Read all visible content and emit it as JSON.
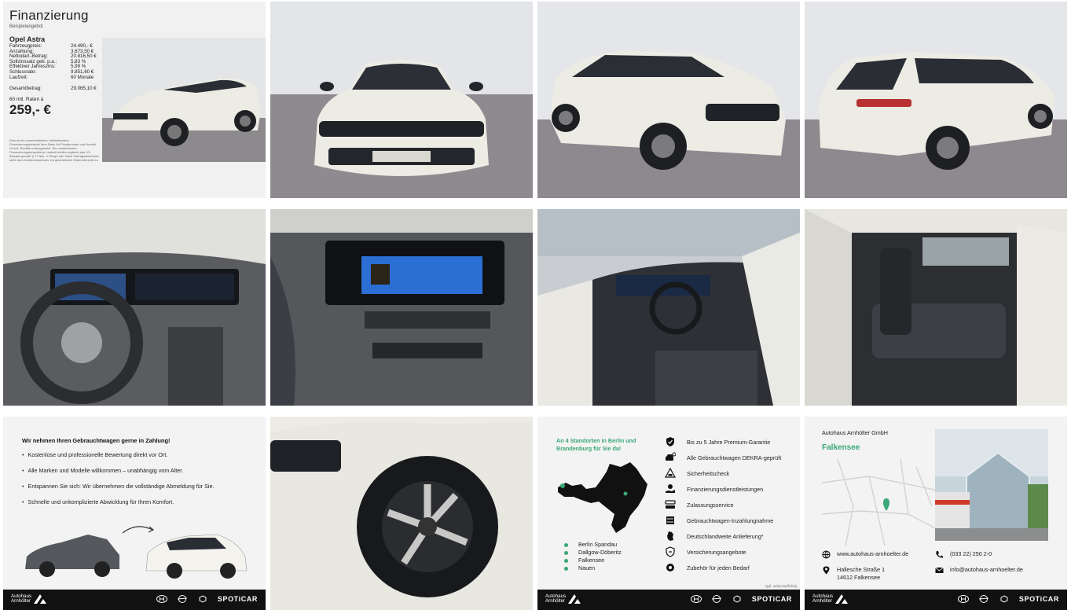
{
  "financing": {
    "title": "Finanzierung",
    "subtitle": "Beispielangebot",
    "model": "Opel Astra",
    "rows": [
      {
        "label": "Fahrzeugpreis:",
        "value": "24.490,- €"
      },
      {
        "label": "Anzahlung:",
        "value": "3.673,50 €"
      },
      {
        "label": "Nettodarl.-Betrag:",
        "value": "20.816,50 €"
      },
      {
        "label": "Sollzinssatz geb. p.a.:",
        "value": "5,83 %"
      },
      {
        "label": "Effektiver Jahreszins:",
        "value": "5,99 %"
      },
      {
        "label": "Schlussrate:",
        "value": "9.851,60 €"
      },
      {
        "label": "Laufzeit:",
        "value": "60 Monate"
      }
    ],
    "total_label": "Gesamtbetrag:",
    "total_value": "29.065,10 €",
    "rates_label": "60 mtl. Raten à",
    "rate_value": "259,- €",
    "disclaimer": "Dies ist ein unverbindliches, freibleibendes Finanzierungsbeispiel Ihrer Bank für Privatkunden und Handel GmbH. Bonität vorausgesetzt. Die vorstehenden Finanzierungsbeispiele je Laufzeit stellen zugleich das 2/3 Beispiel gemäß § 17 Abs. 4 PAngV dar. Nach Vertragsabschluss steht dem Darlehensnehmer ein gesetzliches Widerrufsrecht zu."
  },
  "tradein": {
    "heading": "Wir nehmen Ihren Gebrauchtwagen gerne in Zahlung!",
    "items": [
      "Kostenlose und professionelle Bewertung direkt vor Ort.",
      "Alle Marken und Modelle willkommen – unabhängig vom Alter.",
      "Entspannen Sie sich: Wir übernehmen die vollständige Abmeldung für Sie.",
      "Schnelle und unkomplizierte Abwicklung für Ihren Komfort."
    ]
  },
  "footer": {
    "brand_line1": "Autohaus",
    "brand_line2": "Arnhölter",
    "spoticar": "SPOTiCAR"
  },
  "locations": {
    "heading": "An 4 Standorten in Berlin und Brandenburg für Sie da!",
    "places": [
      "Berlin Spandau",
      "Dallgow-Döberitz",
      "Falkensee",
      "Nauen"
    ],
    "features": [
      {
        "icon": "shield-check-icon",
        "label": "Bis zu 5 Jahre Premium-Garantie"
      },
      {
        "icon": "car-inspection-icon",
        "label": "Alle Gebrauchtwagen DEKRA-geprüft"
      },
      {
        "icon": "warning-car-icon",
        "label": "Sicherheitscheck"
      },
      {
        "icon": "money-hand-icon",
        "label": "Finanzierungsdienstleistungen"
      },
      {
        "icon": "license-plate-icon",
        "label": "Zulassungsservice"
      },
      {
        "icon": "car-swap-icon",
        "label": "Gebrauchtwagen-Inzahlungnahme"
      },
      {
        "icon": "germany-map-icon",
        "label": "Deutschlandweite Anlieferung*"
      },
      {
        "icon": "insurance-shield-icon",
        "label": "Versicherungsangebote"
      },
      {
        "icon": "accessories-gear-icon",
        "label": "Zubehör für jeden Bedarf"
      }
    ],
    "note": "*ggf. aufpreispflichtig"
  },
  "contact": {
    "company": "Autohaus Arnhölter GmbH",
    "city": "Falkensee",
    "website": "www.autohaus-arnhoelter.de",
    "phone": "(033 22) 250 2-0",
    "street": "Hallesche Straße 1",
    "zip_city": "14612 Falkensee",
    "email": "info@autohaus-arnhoelter.de"
  },
  "colors": {
    "accent_green": "#3aa776",
    "footer_black": "#111111",
    "car_white": "#ecebe4"
  }
}
